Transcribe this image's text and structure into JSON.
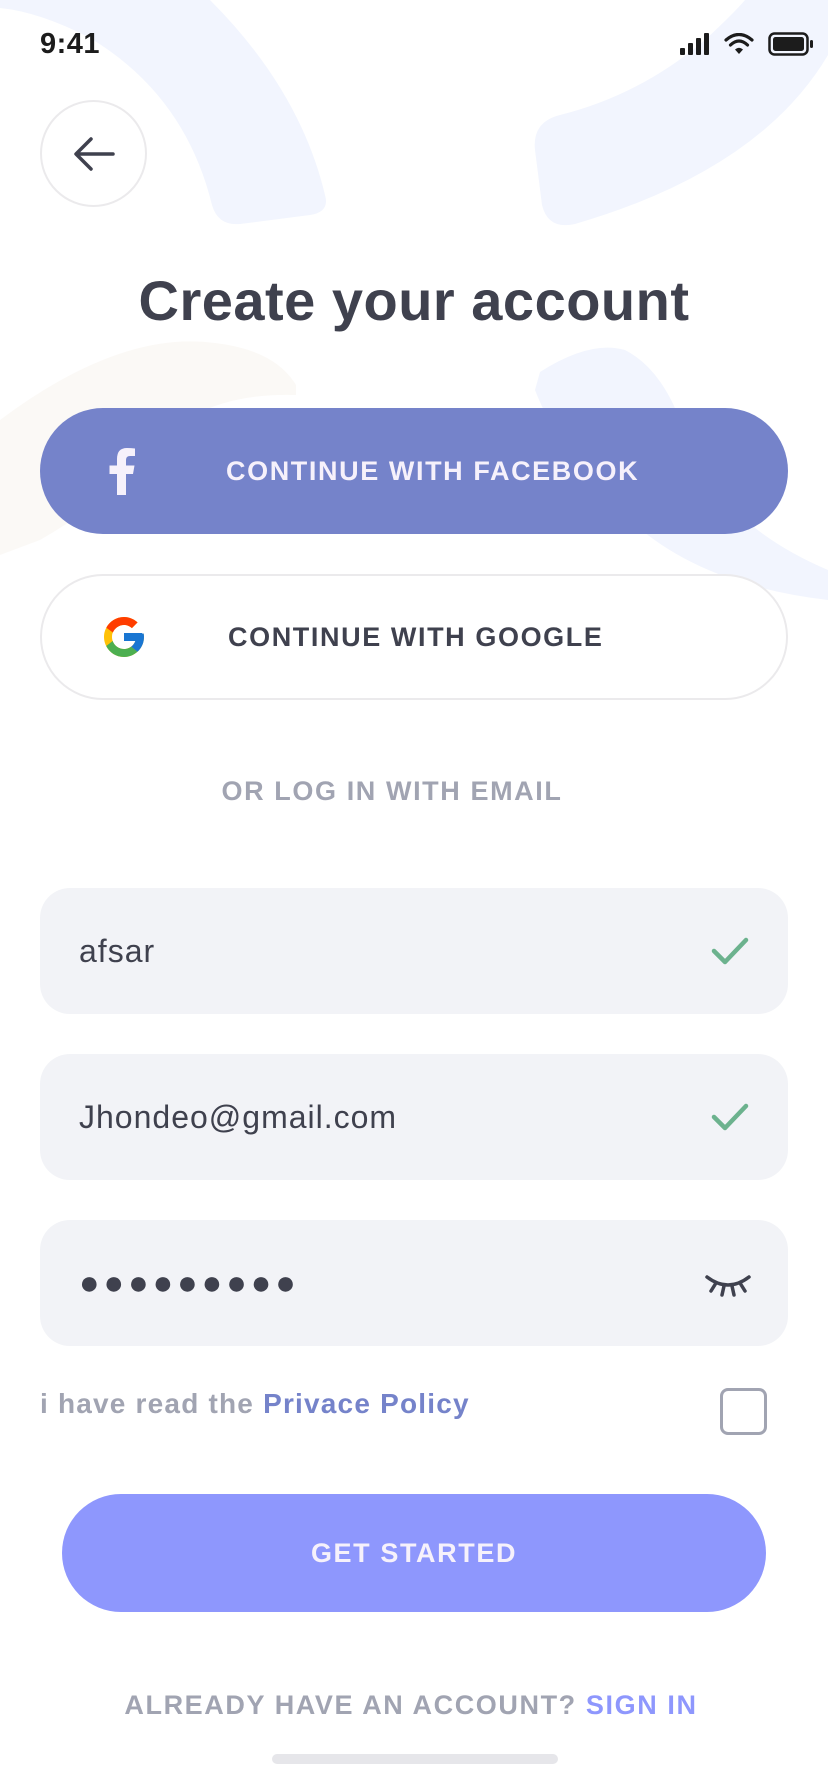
{
  "status_bar": {
    "time": "9:41",
    "icons": [
      "cellular-signal-icon",
      "wifi-icon",
      "battery-icon"
    ]
  },
  "nav": {
    "back_icon": "arrow-left-icon"
  },
  "title": "Create your account",
  "social": {
    "facebook": {
      "label": "CONTINUE WITH FACEBOOK",
      "icon": "facebook-icon"
    },
    "google": {
      "label": "CONTINUE WITH GOOGLE",
      "icon": "google-icon"
    }
  },
  "divider_label": "OR LOG IN WITH EMAIL",
  "form": {
    "name": {
      "value": "afsar",
      "status_icon": "checkmark-icon"
    },
    "email": {
      "value": "Jhondeo@gmail.com",
      "status_icon": "checkmark-icon"
    },
    "password": {
      "masked": "●●●●●●●●●",
      "toggle_icon": "eye-closed-icon"
    },
    "policy": {
      "prefix": "i have read the ",
      "link": "Privace Policy",
      "checked": false
    }
  },
  "cta_label": "GET STARTED",
  "signin": {
    "prefix": "ALREADY HAVE AN ACCOUNT? ",
    "link": "SIGN IN"
  },
  "colors": {
    "facebook": "#7583ca",
    "primary": "#8e97fd",
    "text": "#3f414e",
    "muted": "#a1a4b2",
    "field_bg": "#f2f3f7",
    "success": "#6cb28e"
  }
}
